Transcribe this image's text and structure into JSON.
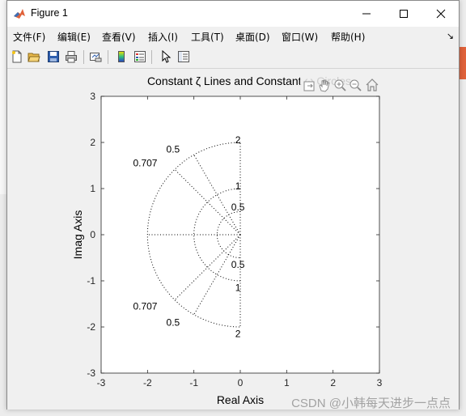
{
  "window": {
    "title": "Figure 1",
    "menu": [
      {
        "label": "文件(F)"
      },
      {
        "label": "编辑(E)"
      },
      {
        "label": "查看(V)"
      },
      {
        "label": "插入(I)"
      },
      {
        "label": "工具(T)"
      },
      {
        "label": "桌面(D)"
      },
      {
        "label": "窗口(W)"
      },
      {
        "label": "帮助(H)"
      }
    ],
    "toolbar_icons": [
      "new-figure-icon",
      "open-file-icon",
      "save-icon",
      "print-icon",
      "link-plot-icon",
      "insert-colorbar-icon",
      "insert-legend-icon",
      "edit-plot-arrow-icon",
      "property-inspector-icon"
    ],
    "axes_toolbar_icons": [
      "export-icon",
      "pan-hand-icon",
      "zoom-in-icon",
      "zoom-out-icon",
      "home-icon"
    ]
  },
  "chart_data": {
    "type": "line",
    "title": "Constant ζ Lines and Constant ω Circles",
    "xlabel": "Real Axis",
    "ylabel": "Imag Axis",
    "xlim": [
      -3,
      3
    ],
    "ylim": [
      -3,
      3
    ],
    "xticks": [
      -3,
      -2,
      -1,
      0,
      1,
      2,
      3
    ],
    "yticks": [
      -3,
      -2,
      -1,
      0,
      1,
      2,
      3
    ],
    "line_style": "dotted",
    "color": "#000000",
    "zeta_lines": [
      0.5,
      0.707
    ],
    "omega_circles": [
      0.5,
      1,
      2
    ],
    "zeta_labels": [
      "0.5",
      "0.707",
      "0.707",
      "0.5"
    ],
    "omega_labels": [
      "2",
      "1",
      "0.5",
      "0.5",
      "1",
      "2"
    ]
  },
  "watermark": "CSDN @小韩每天进步一点点",
  "colors": {
    "axes_bg": "#ffffff",
    "figure_bg": "#f0f0f0",
    "matlab_orange": "#e0623a"
  }
}
